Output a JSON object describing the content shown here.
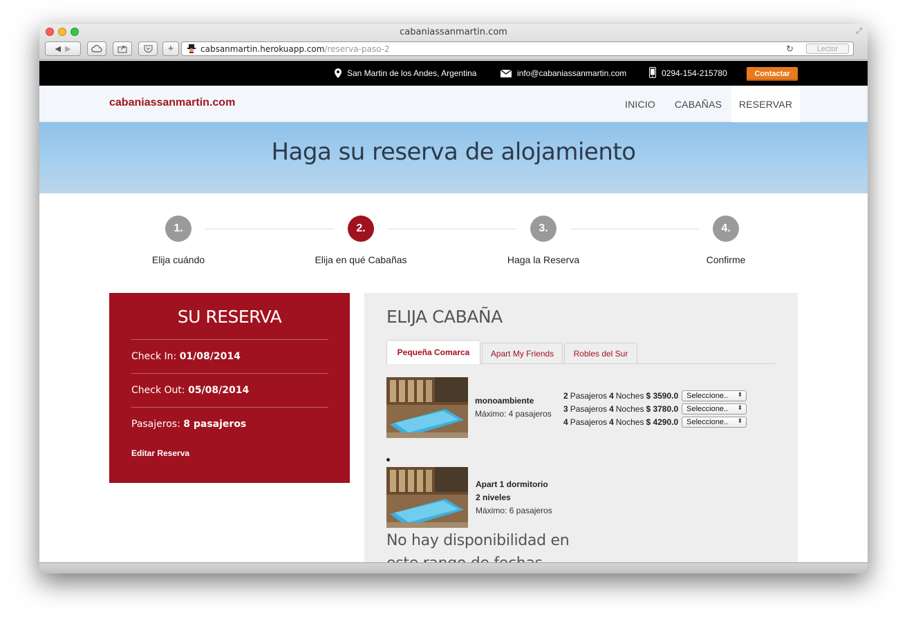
{
  "browser": {
    "window_title": "cabaniassanmartin.com",
    "url_host": "cabsanmartin.herokuapp.com",
    "url_path": "/reserva-paso-2",
    "reader_label": "Lector"
  },
  "topbar": {
    "location": "San Martin de los Andes, Argentina",
    "email": "info@cabaniassanmartin.com",
    "phone": "0294-154-215780",
    "contact_label": "Contactar"
  },
  "navbar": {
    "brand": "cabaniassanmartin.com",
    "items": [
      {
        "label": "INICIO"
      },
      {
        "label": "CABAÑAS"
      },
      {
        "label": "RESERVAR"
      }
    ]
  },
  "hero": {
    "title": "Haga su reserva de alojamiento"
  },
  "steps": [
    {
      "number": "1.",
      "label": "Elija cuándo"
    },
    {
      "number": "2.",
      "label": "Elija en qué Cabañas"
    },
    {
      "number": "3.",
      "label": "Haga la Reserva"
    },
    {
      "number": "4.",
      "label": "Confirme"
    }
  ],
  "reservation": {
    "title": "SU RESERVA",
    "checkin_label": "Check In: ",
    "checkin_value": "01/08/2014",
    "checkout_label": "Check Out: ",
    "checkout_value": "05/08/2014",
    "guests_label": "Pasajeros: ",
    "guests_value": "8 pasajeros",
    "edit_label": "Editar Reserva"
  },
  "cabins": {
    "title": "ELIJA CABAÑA",
    "tabs": [
      {
        "label": "Pequeña Comarca"
      },
      {
        "label": "Apart My Friends"
      },
      {
        "label": "Robles del Sur"
      }
    ],
    "rooms": [
      {
        "name": "monoambiente",
        "max": "Máximo: 4 pasajeros",
        "prices": [
          {
            "guests": "2",
            "nights": "4",
            "price": "$ 3590.0",
            "select": "Seleccione.."
          },
          {
            "guests": "3",
            "nights": "4",
            "price": "$ 3780.0",
            "select": "Seleccione.."
          },
          {
            "guests": "4",
            "nights": "4",
            "price": "$ 4290.0",
            "select": "Seleccione.."
          }
        ]
      },
      {
        "name_line1": "Apart 1 dormitorio",
        "name_line2": "2 niveles",
        "max": "Máximo: 6 pasajeros"
      }
    ],
    "passengers_word": "Pasajeros",
    "nights_word": "Noches",
    "no_availability": "No hay disponibilidad en este rango de fechas"
  },
  "colors": {
    "brand": "#a0121f",
    "contact": "#e97a1d",
    "hero": "#8ec1ea"
  }
}
